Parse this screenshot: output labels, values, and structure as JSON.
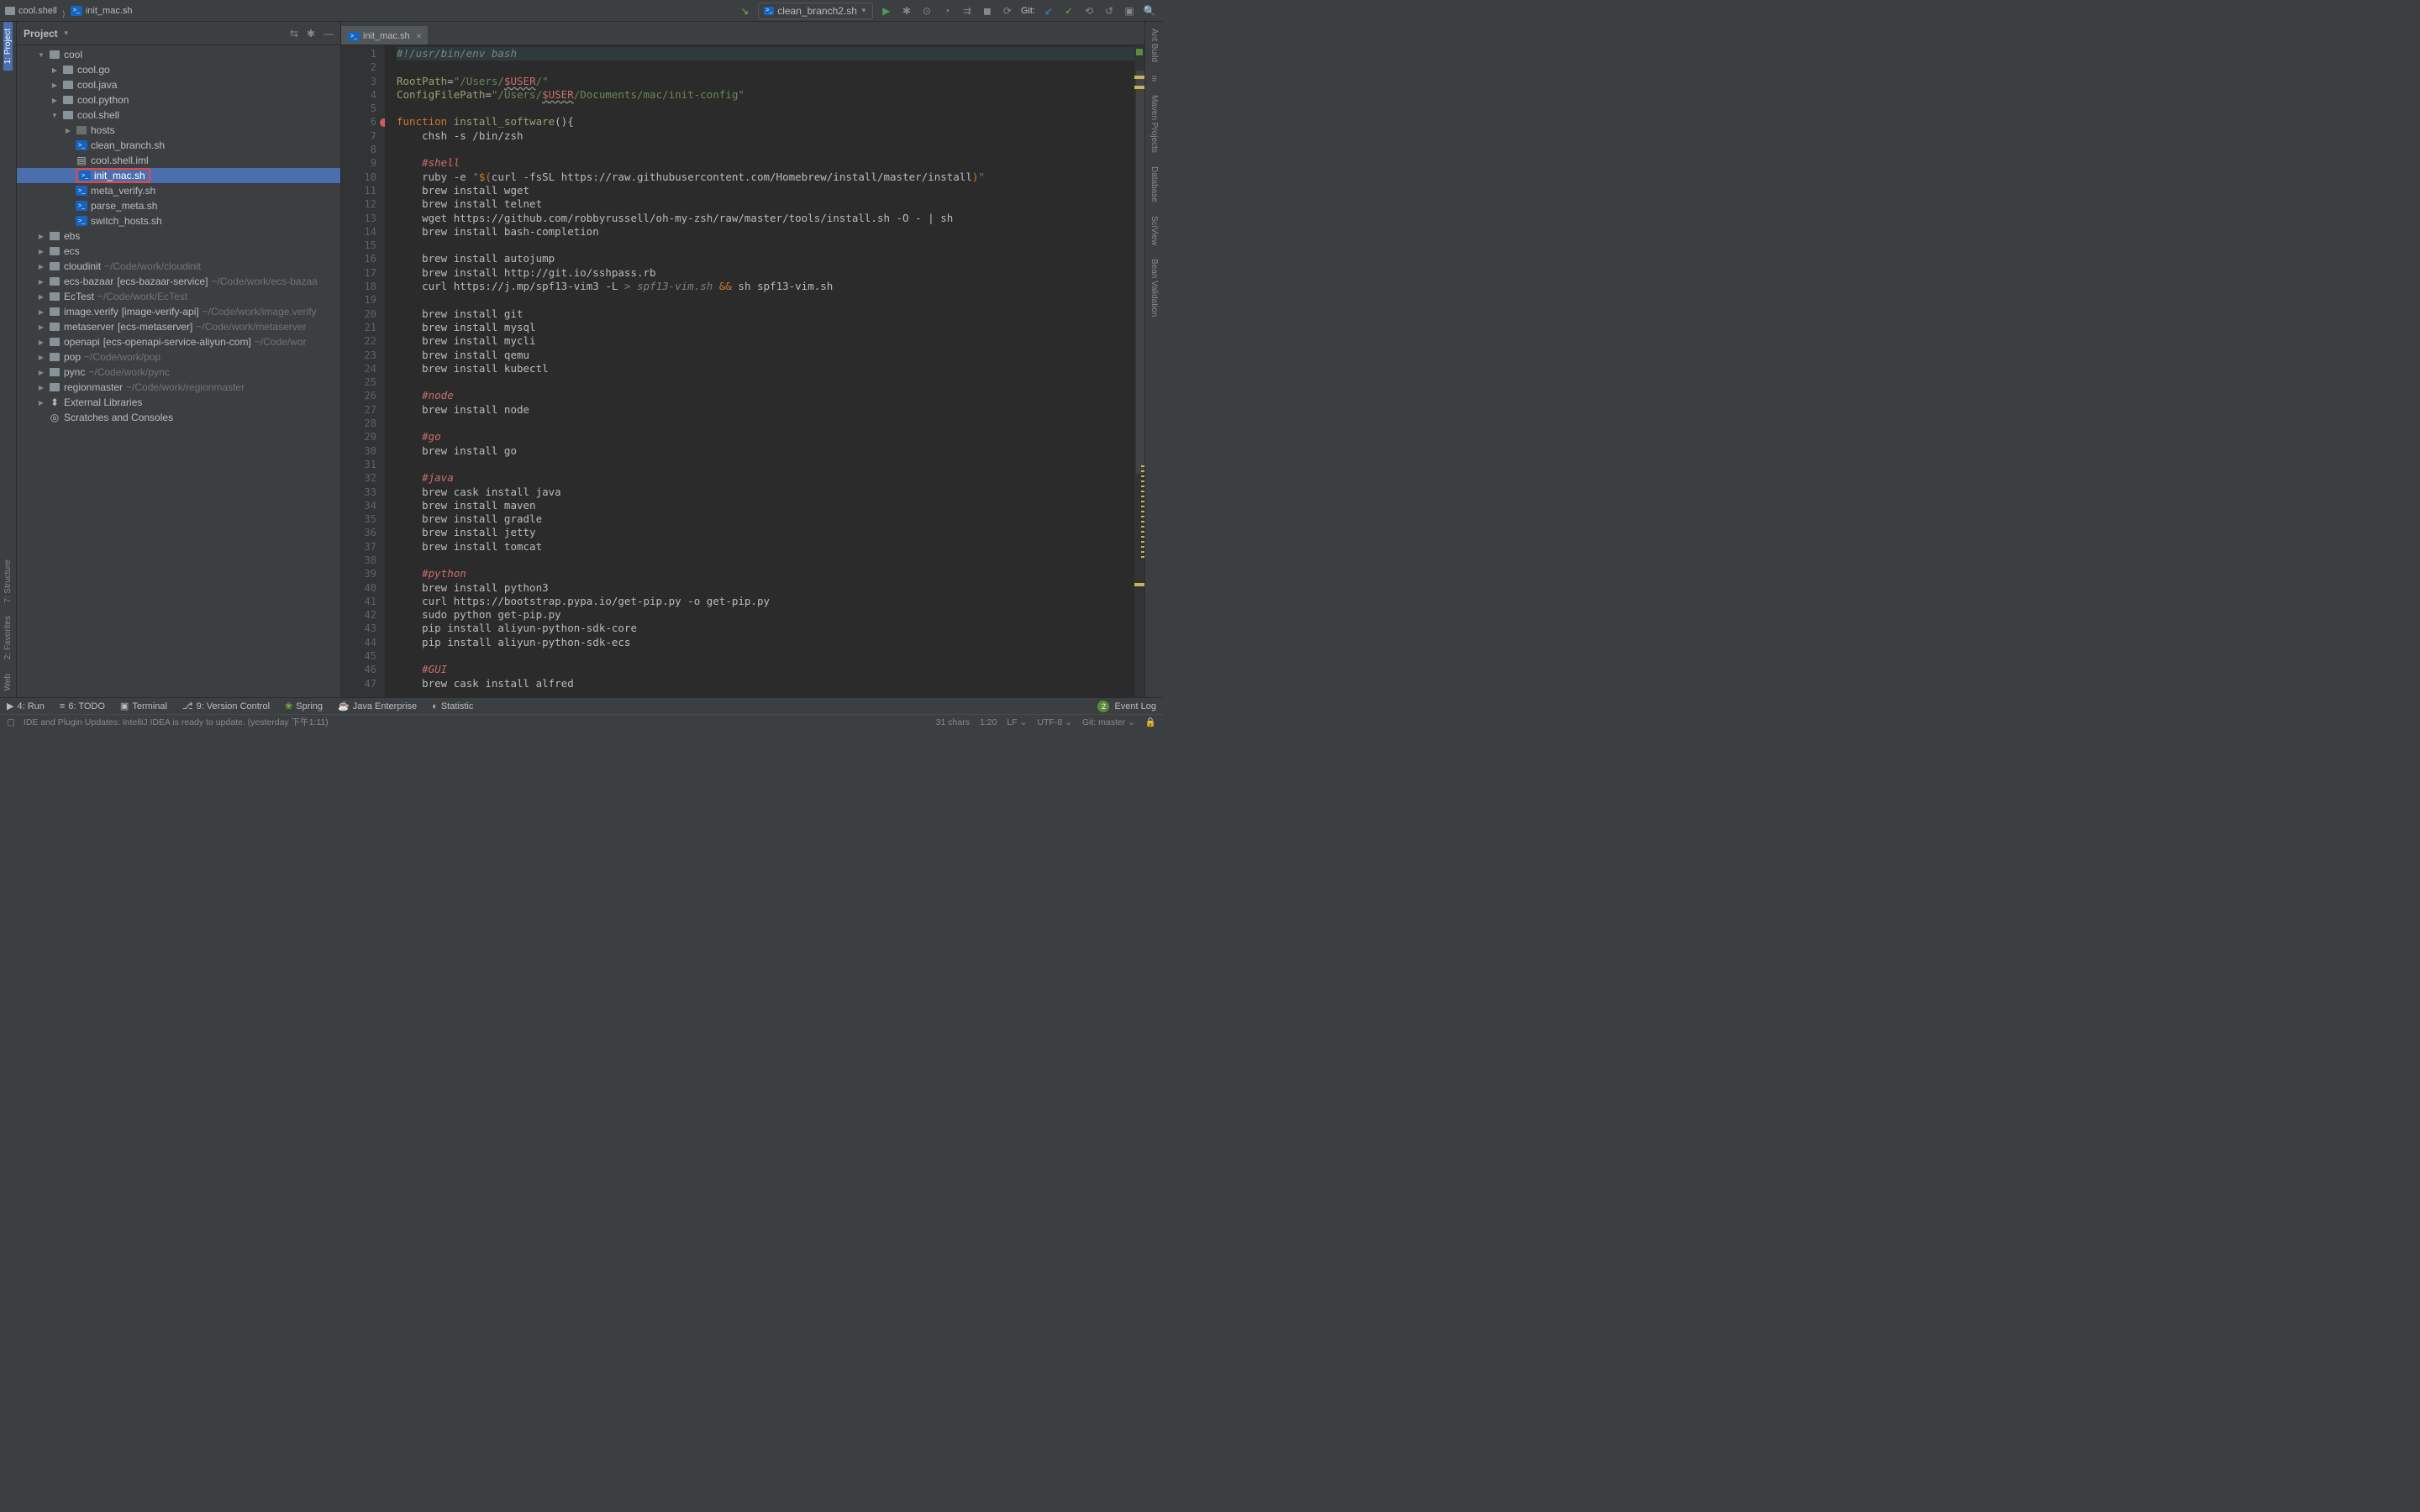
{
  "breadcrumb": {
    "items": [
      {
        "label": "cool.shell",
        "icon": "folder"
      },
      {
        "label": "init_mac.sh",
        "icon": "sh"
      }
    ]
  },
  "toolbar_right": {
    "run_config_label": "clean_branch2.sh",
    "git_label": "Git:"
  },
  "project_panel": {
    "title": "Project"
  },
  "left_tools": {
    "project": "1: Project",
    "structure": "7: Structure",
    "favorites": "2: Favorites",
    "web": "Web"
  },
  "right_tools": {
    "ant": "Ant Build",
    "maven": "Maven Projects",
    "database": "Database",
    "sciview": "SciView",
    "bean": "Bean Validation"
  },
  "tree": [
    {
      "depth": 1,
      "chev": "down",
      "icon": "folder-root",
      "label": "cool"
    },
    {
      "depth": 2,
      "chev": "right",
      "icon": "folder",
      "label": "cool.go"
    },
    {
      "depth": 2,
      "chev": "right",
      "icon": "folder",
      "label": "cool.java"
    },
    {
      "depth": 2,
      "chev": "right",
      "icon": "folder",
      "label": "cool.python"
    },
    {
      "depth": 2,
      "chev": "down",
      "icon": "folder",
      "label": "cool.shell"
    },
    {
      "depth": 3,
      "chev": "right",
      "icon": "folder-plain",
      "label": "hosts"
    },
    {
      "depth": 3,
      "chev": "",
      "icon": "sh",
      "label": "clean_branch.sh"
    },
    {
      "depth": 3,
      "chev": "",
      "icon": "file",
      "label": "cool.shell.iml"
    },
    {
      "depth": 3,
      "chev": "",
      "icon": "sh",
      "label": "init_mac.sh",
      "selected": true
    },
    {
      "depth": 3,
      "chev": "",
      "icon": "sh",
      "label": "meta_verify.sh"
    },
    {
      "depth": 3,
      "chev": "",
      "icon": "sh",
      "label": "parse_meta.sh"
    },
    {
      "depth": 3,
      "chev": "",
      "icon": "sh",
      "label": "switch_hosts.sh"
    },
    {
      "depth": 1,
      "chev": "right",
      "icon": "folder-root",
      "label": "ebs"
    },
    {
      "depth": 1,
      "chev": "right",
      "icon": "folder-root",
      "label": "ecs"
    },
    {
      "depth": 1,
      "chev": "right",
      "icon": "folder-root",
      "label": "cloudinit",
      "suffix": "~/Code/work/cloudinit"
    },
    {
      "depth": 1,
      "chev": "right",
      "icon": "folder-root",
      "label": "ecs-bazaar",
      "bracket": "[ecs-bazaar-service]",
      "suffix": "~/Code/work/ecs-bazaa"
    },
    {
      "depth": 1,
      "chev": "right",
      "icon": "folder-root",
      "label": "EcTest",
      "suffix": "~/Code/work/EcTest"
    },
    {
      "depth": 1,
      "chev": "right",
      "icon": "folder-root",
      "label": "image.verify",
      "bracket": "[image-verify-api]",
      "suffix": "~/Code/work/image.verify"
    },
    {
      "depth": 1,
      "chev": "right",
      "icon": "folder-root",
      "label": "metaserver",
      "bracket": "[ecs-metaserver]",
      "suffix": "~/Code/work/metaserver"
    },
    {
      "depth": 1,
      "chev": "right",
      "icon": "folder-root",
      "label": "openapi",
      "bracket": "[ecs-openapi-service-aliyun-com]",
      "suffix": "~/Code/wor"
    },
    {
      "depth": 1,
      "chev": "right",
      "icon": "folder-root",
      "label": "pop",
      "suffix": "~/Code/work/pop"
    },
    {
      "depth": 1,
      "chev": "right",
      "icon": "folder-root",
      "label": "pync",
      "suffix": "~/Code/work/pync"
    },
    {
      "depth": 1,
      "chev": "right",
      "icon": "folder-root",
      "label": "regionmaster",
      "suffix": "~/Code/work/regionmaster"
    },
    {
      "depth": 1,
      "chev": "right",
      "icon": "lib",
      "label": "External Libraries"
    },
    {
      "depth": 1,
      "chev": "",
      "icon": "scratch",
      "label": "Scratches and Consoles"
    }
  ],
  "editor": {
    "tab_label": "init_mac.sh",
    "lines": [
      {
        "n": 1,
        "hl": true,
        "html": "<span class='c-comment'>#!/usr/bin/env bash</span>"
      },
      {
        "n": 2,
        "html": ""
      },
      {
        "n": 3,
        "html": "<span class='c-id'>RootPath</span>=<span class='c-str'>\"/Users/</span><span class='c-red c-underline'>$USER</span><span class='c-str'>/\"</span>"
      },
      {
        "n": 4,
        "html": "<span class='c-id'>ConfigFilePath</span>=<span class='c-str'>\"/Users/</span><span class='c-red c-underline'>$USER</span><span class='c-str'>/Documents/mac/init-config\"</span>"
      },
      {
        "n": 5,
        "html": ""
      },
      {
        "n": 6,
        "dot": true,
        "html": "<span class='c-key'>function</span> <span class='c-id'>install_software</span>(){"
      },
      {
        "n": 7,
        "html": "    chsh -s /bin/zsh"
      },
      {
        "n": 8,
        "html": ""
      },
      {
        "n": 9,
        "html": "    <span class='c-italic-red'>#shell</span>"
      },
      {
        "n": 10,
        "html": "    ruby -e <span class='c-str'>\"</span><span class='c-key'>$(</span>curl -fsSL https://raw.githubusercontent.com/Homebrew/install/master/install<span class='c-key'>)</span><span class='c-str'>\"</span>"
      },
      {
        "n": 11,
        "html": "    brew install wget"
      },
      {
        "n": 12,
        "html": "    brew install telnet"
      },
      {
        "n": 13,
        "html": "    wget https://github.com/robbyrussell/oh-my-zsh/raw/master/tools/install.sh -O - | sh"
      },
      {
        "n": 14,
        "html": "    brew install bash-completion"
      },
      {
        "n": 15,
        "html": ""
      },
      {
        "n": 16,
        "html": "    brew install autojump"
      },
      {
        "n": 17,
        "html": "    brew install http://git.io/sshpass.rb"
      },
      {
        "n": 18,
        "html": "    curl https://j.mp/spf13-vim3 -L <span class='c-comment'>&gt; spf13-vim.sh</span> <span class='c-key'>&amp;&amp;</span> sh spf13-vim.sh"
      },
      {
        "n": 19,
        "html": ""
      },
      {
        "n": 20,
        "html": "    brew install git"
      },
      {
        "n": 21,
        "html": "    brew install mysql"
      },
      {
        "n": 22,
        "html": "    brew install mycli"
      },
      {
        "n": 23,
        "html": "    brew install qemu"
      },
      {
        "n": 24,
        "html": "    brew install kubectl"
      },
      {
        "n": 25,
        "html": ""
      },
      {
        "n": 26,
        "html": "    <span class='c-italic-red'>#node</span>"
      },
      {
        "n": 27,
        "html": "    brew install node"
      },
      {
        "n": 28,
        "html": ""
      },
      {
        "n": 29,
        "html": "    <span class='c-italic-red'>#go</span>"
      },
      {
        "n": 30,
        "html": "    brew install go"
      },
      {
        "n": 31,
        "html": ""
      },
      {
        "n": 32,
        "html": "    <span class='c-italic-red'>#java</span>"
      },
      {
        "n": 33,
        "html": "    brew cask install java"
      },
      {
        "n": 34,
        "html": "    brew install maven"
      },
      {
        "n": 35,
        "html": "    brew install gradle"
      },
      {
        "n": 36,
        "html": "    brew install jetty"
      },
      {
        "n": 37,
        "html": "    brew install tomcat"
      },
      {
        "n": 38,
        "html": ""
      },
      {
        "n": 39,
        "html": "    <span class='c-italic-red'>#python</span>"
      },
      {
        "n": 40,
        "html": "    brew install python3"
      },
      {
        "n": 41,
        "html": "    curl https://bootstrap.pypa.io/get-pip.py -o get-pip.py"
      },
      {
        "n": 42,
        "html": "    sudo python get-pip.py"
      },
      {
        "n": 43,
        "html": "    pip install aliyun-python-sdk-core"
      },
      {
        "n": 44,
        "html": "    pip install aliyun-python-sdk-ecs"
      },
      {
        "n": 45,
        "html": ""
      },
      {
        "n": 46,
        "html": "    <span class='c-italic-red'>#GUI</span>"
      },
      {
        "n": 47,
        "html": "    brew cask install alfred"
      }
    ]
  },
  "bottom_tools": {
    "run": "4: Run",
    "todo": "6: TODO",
    "terminal": "Terminal",
    "vcs": "9: Version Control",
    "spring": "Spring",
    "java_ee": "Java Enterprise",
    "statistic": "Statistic",
    "event_log": "Event Log",
    "event_log_badge": "2"
  },
  "status_bar": {
    "message": "IDE and Plugin Updates: IntelliJ IDEA is ready to update. (yesterday 下午1:11)",
    "chars": "31 chars",
    "pos": "1:20",
    "lf": "LF",
    "enc": "UTF-8",
    "git": "Git: master"
  }
}
